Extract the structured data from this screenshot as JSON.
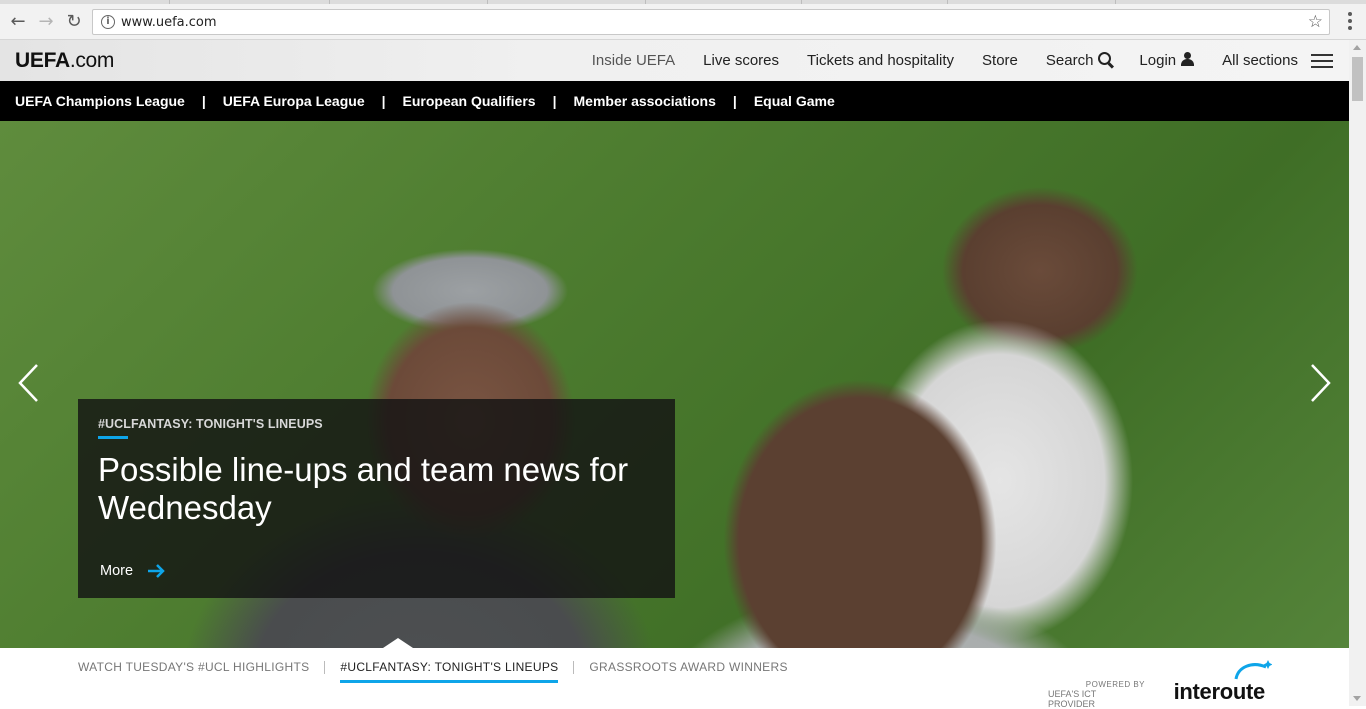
{
  "browser": {
    "url": "www.uefa.com",
    "back_icon": "arrow-left-icon",
    "forward_icon": "arrow-right-icon",
    "reload_icon": "reload-icon",
    "info_icon": "info-icon",
    "bookmark_icon": "star-icon",
    "menu_icon": "kebab-menu-icon"
  },
  "header": {
    "logo_bold": "UEFA",
    "logo_rest": ".com",
    "nav": {
      "inside": "Inside UEFA",
      "live": "Live scores",
      "tickets": "Tickets and hospitality",
      "store": "Store",
      "search": "Search",
      "login": "Login",
      "all_sections": "All sections"
    }
  },
  "subnav": {
    "items": [
      "UEFA Champions League",
      "UEFA Europa League",
      "European Qualifiers",
      "Member associations",
      "Equal Game"
    ],
    "separator": "|"
  },
  "hero": {
    "kicker": "#UCLFANTASY: TONIGHT'S LINEUPS",
    "headline": "Possible line-ups and team news for Wednesday",
    "more_label": "More"
  },
  "tabs": {
    "items": [
      "WATCH TUESDAY'S #UCL HIGHLIGHTS",
      "#UCLFANTASY: TONIGHT'S LINEUPS",
      "GRASSROOTS AWARD WINNERS"
    ],
    "active": "#UCLFANTASY: TONIGHT'S LINEUPS"
  },
  "sponsor": {
    "powered_by": "POWERED BY",
    "provider": "UEFA'S ICT PROVIDER",
    "brand": "interoute"
  },
  "colors": {
    "accent": "#0ea5e9",
    "subnav_bg": "#000000",
    "card_bg": "#141414"
  }
}
